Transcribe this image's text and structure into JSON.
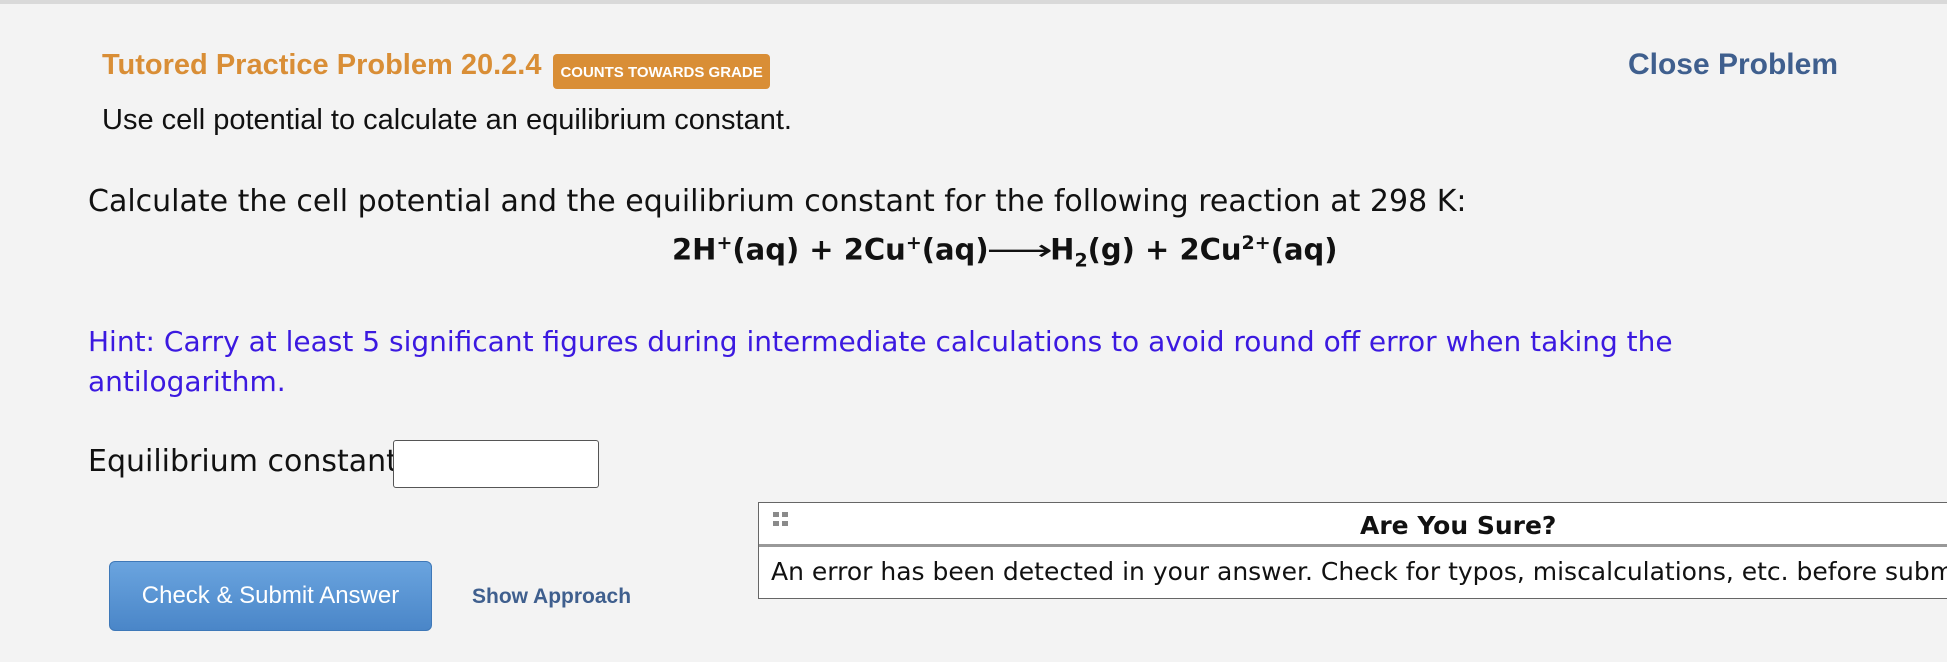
{
  "header": {
    "title": "Tutored Practice Problem 20.2.4",
    "badge": "COUNTS TOWARDS GRADE",
    "close_label": "Close Problem",
    "subtitle": "Use cell potential to calculate an equilibrium constant."
  },
  "question": {
    "prompt": "Calculate the cell potential and the equilibrium constant for the following reaction at 298 K:",
    "equation": {
      "reactant1_coef": "2H",
      "reactant1_charge": "+",
      "reactant1_state": "(aq) + ",
      "reactant2_coef": "2Cu",
      "reactant2_charge": "+",
      "reactant2_state": "(aq)",
      "arrow": "⟶",
      "product1": "H",
      "product1_sub": "2",
      "product1_state": "(g) + ",
      "product2_coef": "2Cu",
      "product2_charge": "2+",
      "product2_state": "(aq)"
    },
    "hint": "Hint: Carry at least 5 significant figures during intermediate calculations to avoid round off error when taking the antilogarithm."
  },
  "answer": {
    "label": "Equilibrium constant:",
    "value": "",
    "placeholder": ""
  },
  "actions": {
    "submit_label": "Check & Submit Answer",
    "approach_label": "Show Approach"
  },
  "dialog": {
    "title": "Are You Sure?",
    "message": "An error has been detected in your answer. Check for typos, miscalculations, etc. before submitting"
  }
}
